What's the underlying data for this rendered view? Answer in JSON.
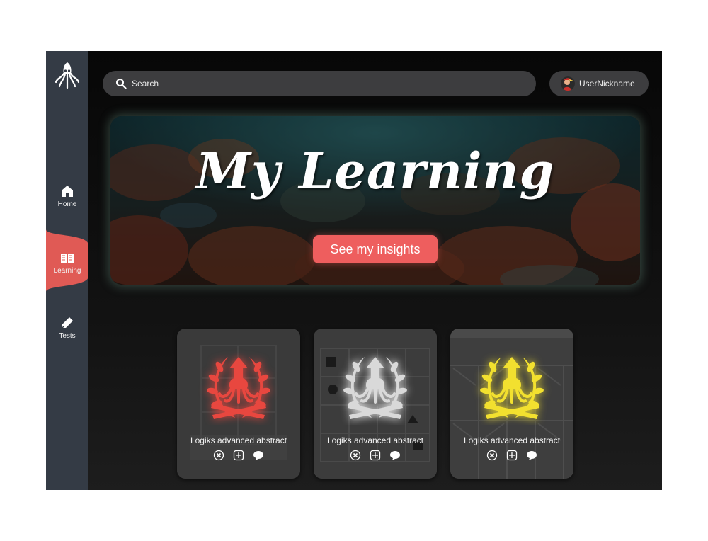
{
  "sidebar": {
    "items": [
      {
        "label": "Home",
        "icon": "home-icon"
      },
      {
        "label": "Learning",
        "icon": "book-icon",
        "active": true
      },
      {
        "label": "Tests",
        "icon": "pen-icon"
      }
    ]
  },
  "header": {
    "search_placeholder": "Search",
    "user_name": "UserNickname"
  },
  "hero": {
    "title": "My Learning",
    "button_label": "See my insights"
  },
  "cards": [
    {
      "title": "Logiks advanced abstract",
      "badge_color": "#e8473f",
      "badge": "laurel-squid-red"
    },
    {
      "title": "Logiks advanced abstract",
      "badge_color": "#d9d9d9",
      "badge": "laurel-squid-silver"
    },
    {
      "title": "Logiks advanced abstract",
      "badge_color": "#f2e02f",
      "badge": "laurel-squid-gold"
    }
  ],
  "colors": {
    "accent": "#ee5e5e",
    "sidebar": "#343b45",
    "background": "#0b0b0b"
  }
}
